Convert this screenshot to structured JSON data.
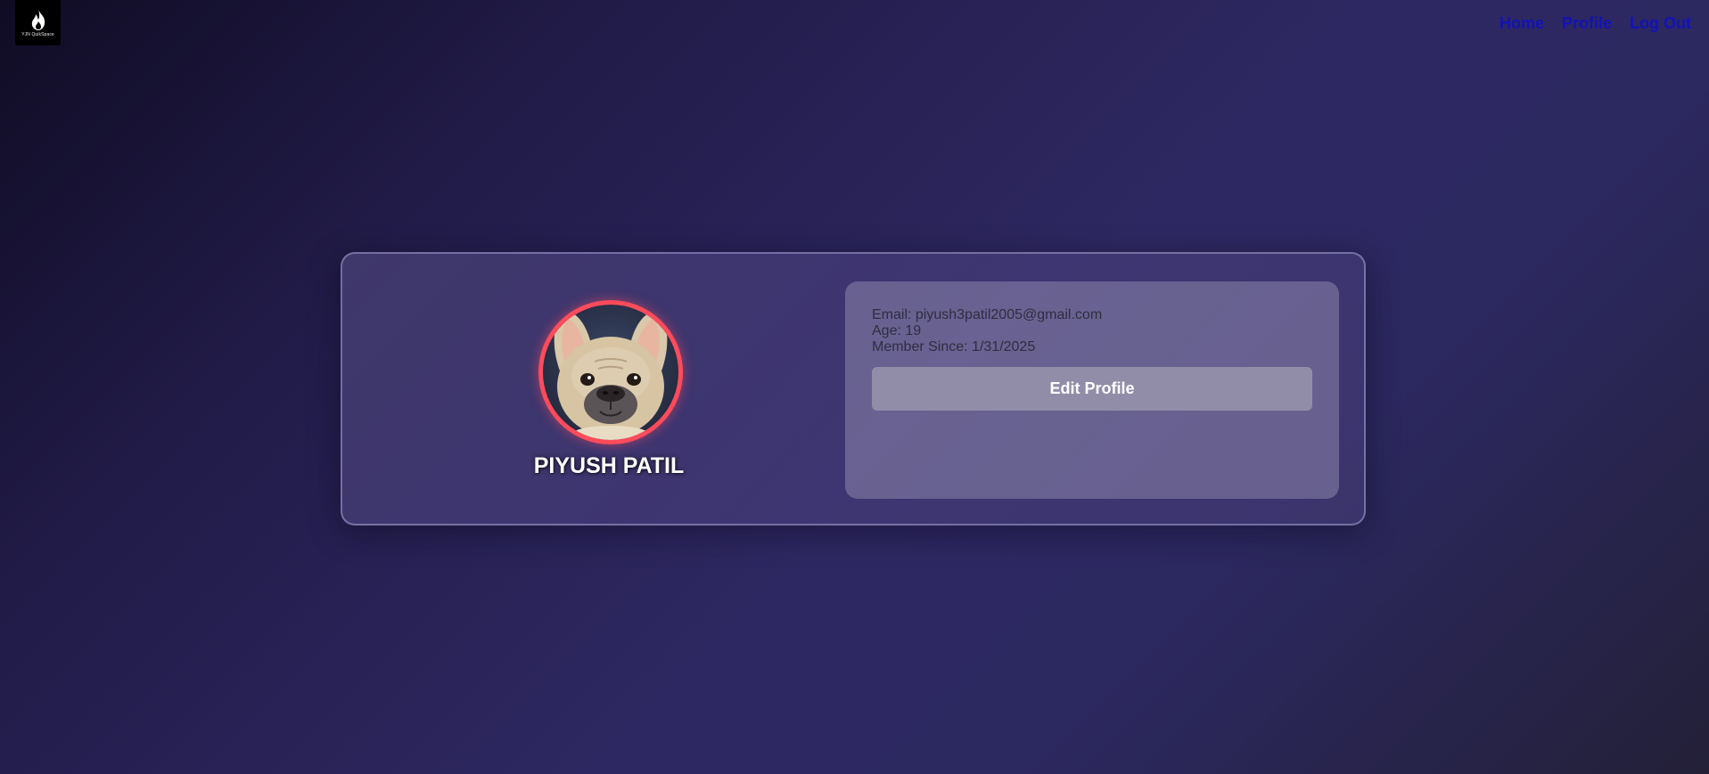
{
  "logo": {
    "text": "YJN QuikSpace",
    "icon": "flame-icon"
  },
  "nav": {
    "home": "Home",
    "profile": "Profile",
    "logout": "Log Out",
    "link_color": "#1212b8"
  },
  "profile": {
    "name": "PIYUSH PATIL",
    "avatar": "french-bulldog-avatar",
    "avatar_border_color": "#ff4b5b",
    "email_label": "Email:",
    "email": "piyush3patil2005@gmail.com",
    "age_label": "Age:",
    "age": "19",
    "member_since_label": "Member Since:",
    "member_since": "1/31/2025",
    "edit_button": "Edit Profile"
  }
}
